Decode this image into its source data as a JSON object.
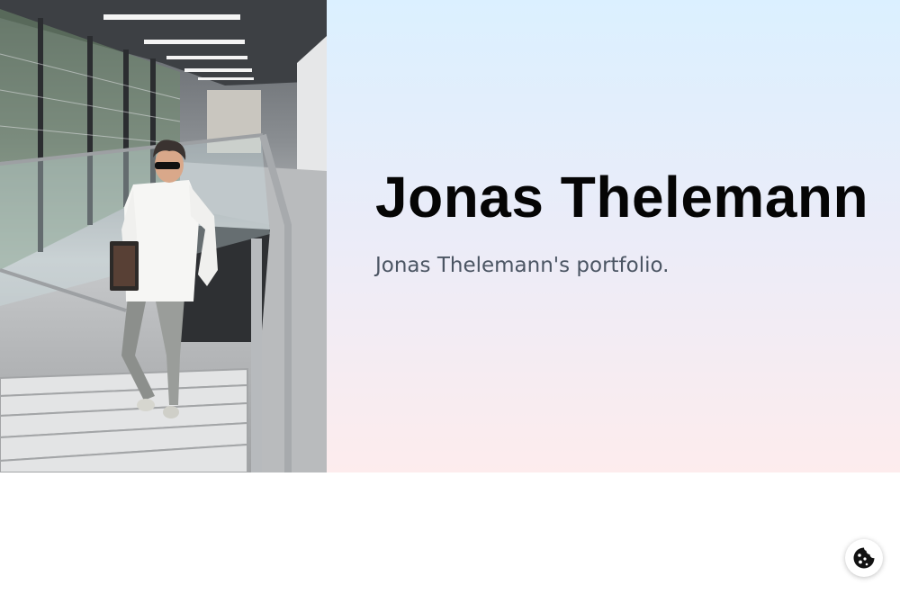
{
  "hero": {
    "name": "Jonas Thelemann",
    "tagline": "Jonas Thelemann's portfolio.",
    "photo_icon": "portrait-photo"
  },
  "cookie_button": {
    "icon": "cookie-icon"
  },
  "colors": {
    "gradient_top": "#dbf0ff",
    "gradient_bottom": "#fdeced",
    "name_text": "#050505",
    "tagline_text": "#4b5563"
  }
}
